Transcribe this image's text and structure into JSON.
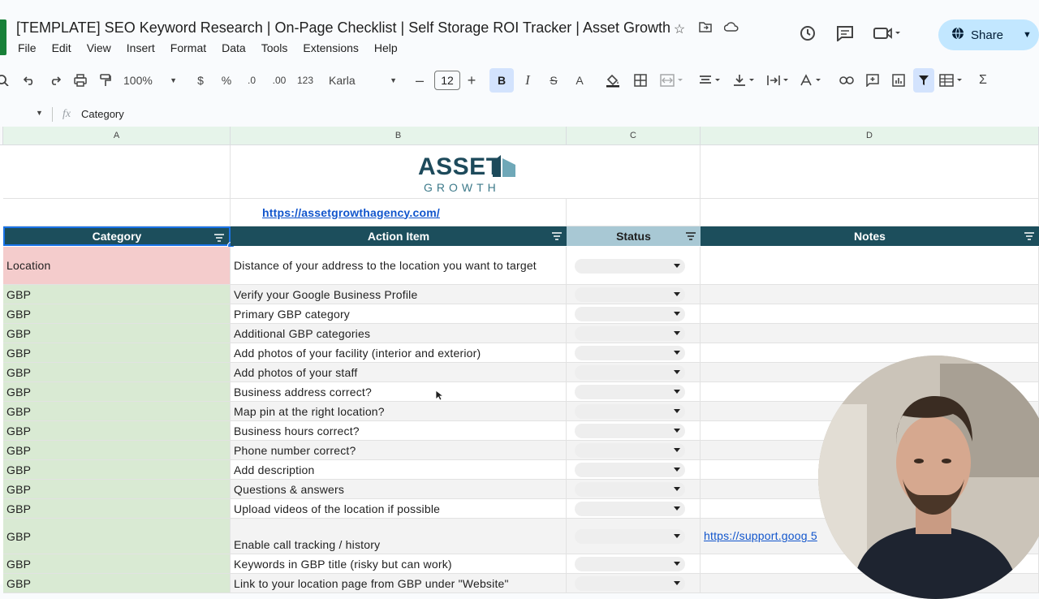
{
  "title": "[TEMPLATE] SEO Keyword Research | On-Page Checklist | Self Storage ROI Tracker | Asset Growth",
  "menu": [
    "File",
    "Edit",
    "View",
    "Insert",
    "Format",
    "Data",
    "Tools",
    "Extensions",
    "Help"
  ],
  "share_label": "Share",
  "toolbar": {
    "zoom": "100%",
    "currency": "$",
    "percent": "%",
    "dec_decrease": ".0",
    "dec_increase": ".00",
    "number_format": "123",
    "font": "Karla",
    "font_size": "12"
  },
  "formula_bar": {
    "fx": "fx",
    "value": "Category"
  },
  "columns": [
    "A",
    "B",
    "C",
    "D"
  ],
  "logo": {
    "word": "ASSET",
    "sub": "GROWTH"
  },
  "url": "https://assetgrowthagency.com/",
  "headers": {
    "category": "Category",
    "action": "Action Item",
    "status": "Status",
    "notes": "Notes"
  },
  "rows": [
    {
      "category": "Location",
      "action": "Distance of your address to the location you want to target",
      "note": ""
    },
    {
      "category": "GBP",
      "action": "Verify your Google Business Profile",
      "note": ""
    },
    {
      "category": "GBP",
      "action": "Primary GBP category",
      "note": ""
    },
    {
      "category": "GBP",
      "action": "Additional GBP categories",
      "note": ""
    },
    {
      "category": "GBP",
      "action": "Add photos of your facility (interior and exterior)",
      "note": ""
    },
    {
      "category": "GBP",
      "action": "Add photos of your staff",
      "note": ""
    },
    {
      "category": "GBP",
      "action": "Business address correct?",
      "note": ""
    },
    {
      "category": "GBP",
      "action": "Map pin at the right location?",
      "note": ""
    },
    {
      "category": "GBP",
      "action": "Business hours correct?",
      "note": ""
    },
    {
      "category": "GBP",
      "action": "Phone number correct?",
      "note": ""
    },
    {
      "category": "GBP",
      "action": "Add description",
      "note": ""
    },
    {
      "category": "GBP",
      "action": "Questions & answers",
      "note": ""
    },
    {
      "category": "GBP",
      "action": "Upload videos of the location if possible",
      "note": ""
    },
    {
      "category": "GBP",
      "action": "Enable call tracking / history",
      "note": "https://support.goog 5"
    },
    {
      "category": "GBP",
      "action": "Keywords in GBP title (risky but can work)",
      "note": ""
    },
    {
      "category": "GBP",
      "action": "Link to your location page from GBP under \"Website\"",
      "note": ""
    }
  ],
  "colors": {
    "header_dark": "#1c4e5c",
    "header_status": "#a8c8d4",
    "category_green": "#d9ead3",
    "location_red": "#f4cccc",
    "accent_blue": "#0b57d0"
  },
  "icons": [
    "search-icon",
    "undo-icon",
    "redo-icon",
    "print-icon",
    "paint-format-icon",
    "bold-icon",
    "italic-icon",
    "strikethrough-icon",
    "text-color-icon",
    "fill-color-icon",
    "borders-icon",
    "merge-icon",
    "align-icon",
    "valign-icon",
    "wrap-icon",
    "rotate-icon",
    "link-icon",
    "comment-icon",
    "chart-icon",
    "filter-icon",
    "table-icon",
    "functions-icon",
    "star-icon",
    "move-icon",
    "cloud-icon",
    "history-icon",
    "comments-icon",
    "meet-icon",
    "globe-icon"
  ]
}
